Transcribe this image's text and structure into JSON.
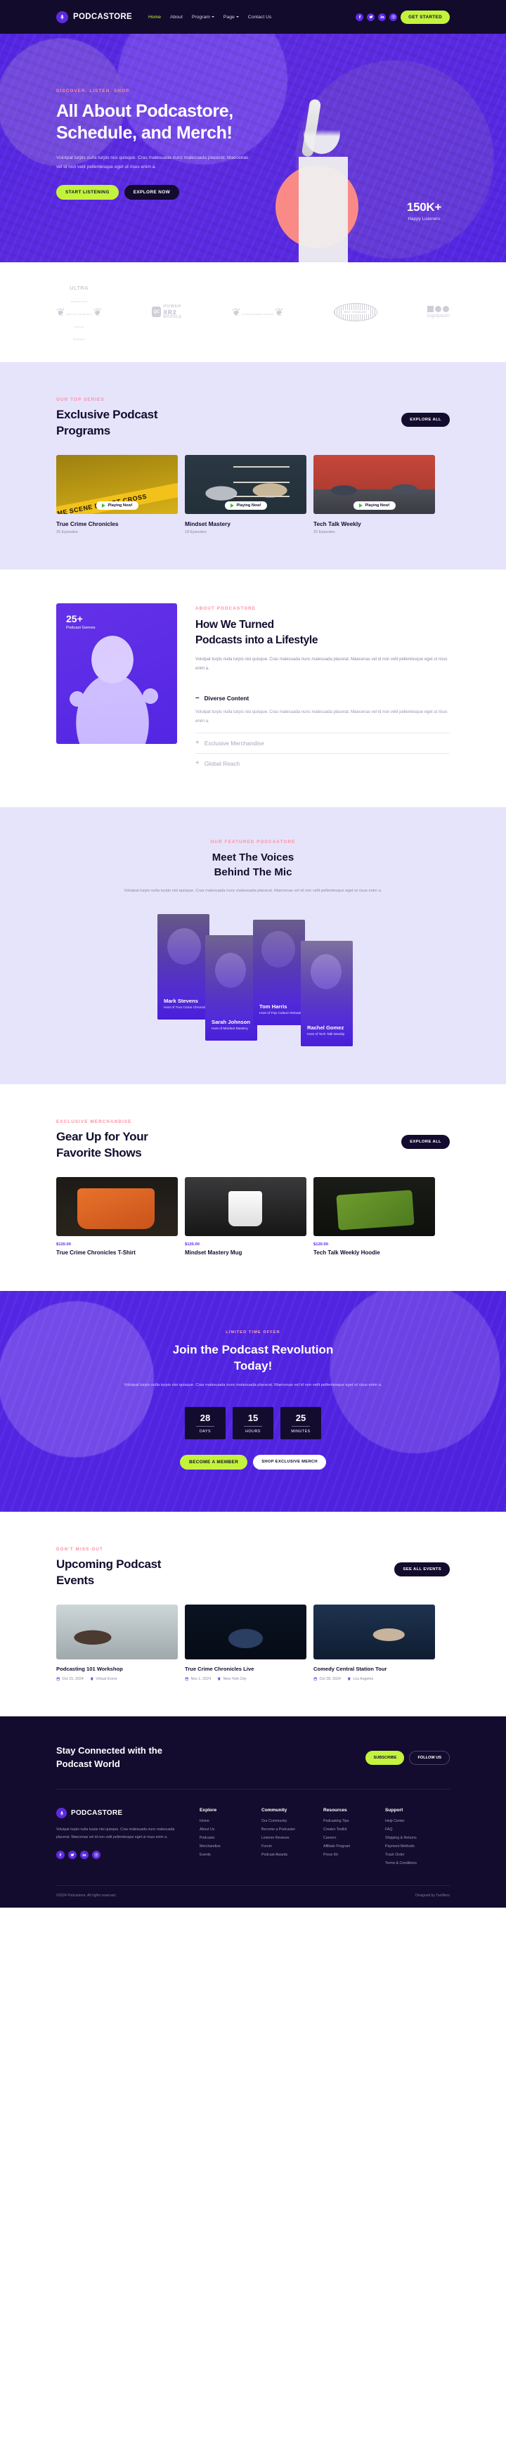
{
  "header": {
    "brand": "PODCASTORE",
    "nav": [
      {
        "label": "Home",
        "active": true,
        "caret": false
      },
      {
        "label": "About",
        "active": false,
        "caret": false
      },
      {
        "label": "Program",
        "active": false,
        "caret": true
      },
      {
        "label": "Page",
        "active": false,
        "caret": true
      },
      {
        "label": "Contact Us",
        "active": false,
        "caret": false
      }
    ],
    "socials": [
      "facebook-icon",
      "twitter-icon",
      "linkedin-icon",
      "instagram-icon"
    ],
    "cta_label": "GET STARTED",
    "accent_lime": "#c3f33c",
    "accent_purple": "#5c2be0",
    "dark": "#140c2e"
  },
  "hero": {
    "eyebrow": "DISCOVER. LISTEN. SHOP.",
    "title_line1": "All About Podcastore,",
    "title_line2": "Schedule, and Merch!",
    "description": "Volutpat turpis nulla turpis nisi quisque. Cras malesuada nunc malesuada placerat. Maecenas vel id non velit pellentesque eget ut risus enim a.",
    "btn_primary": "START LISTENING",
    "btn_secondary": "EXPLORE NOW",
    "stat_number": "150K+",
    "stat_label": "Happy Listeners"
  },
  "logos": [
    {
      "name": "ultra-prestigious-logo",
      "top": "ULTRA",
      "mid": "PRESTIGIOUS",
      "sub": "BEST OF THE WORLD",
      "stars": "★★★★★",
      "bottom": "WINNER"
    },
    {
      "name": "qc-power-xr2-logo",
      "badge": "QC",
      "p1": "POWER",
      "p2": "XR2",
      "p3": "MODULE"
    },
    {
      "name": "laurel-award-logo",
      "text": "ULTIMATE AWARD WINNER"
    },
    {
      "name": "best-standard-oval-logo",
      "text": "BEST STANDARD"
    },
    {
      "name": "logoipsum-logo",
      "text": "logoipsum"
    }
  ],
  "programs": {
    "eyebrow": "OUR TOP SERIES",
    "title_line1": "Exclusive Podcast",
    "title_line2": "Programs",
    "button": "EXPLORE ALL",
    "playing_label": "Playing Now!",
    "cards": [
      {
        "name": "True Crime Chronicles",
        "episodes": "25 Episodes",
        "thumb": "crime-scene-tape-image",
        "tape_text": "CRIME SCENE DO NOT CROSS"
      },
      {
        "name": "Mindset Mastery",
        "episodes": "18 Episodes",
        "thumb": "studio-interview-image",
        "tape_text": ""
      },
      {
        "name": "Tech Talk Weekly",
        "episodes": "32 Episodes",
        "thumb": "team-meeting-image",
        "tape_text": ""
      }
    ]
  },
  "about": {
    "badge_number": "25+",
    "badge_label": "Podcast Genres",
    "eyebrow": "ABOUT PODCASTORE",
    "title_line1": "How We Turned",
    "title_line2": "Podcasts into a Lifestyle",
    "description": "Volutpat turpis nulla turpis nisi quisque. Cras malesuada nunc malesuada placerat. Maecenas vel id non velit pellentesque eget ut risus enim a.",
    "accordion": [
      {
        "title": "Diverse Content",
        "open": true,
        "sign": "–",
        "body": "Volutpat turpis nulla turpis nisi quisque. Cras malesuada nunc malesuada placerat. Maecenas vel id non velit pellentesque eget ut risus enim a."
      },
      {
        "title": "Exclusive Merchandise",
        "open": false,
        "sign": "+",
        "body": ""
      },
      {
        "title": "Global Reach",
        "open": false,
        "sign": "+",
        "body": ""
      }
    ]
  },
  "hosts": {
    "eyebrow": "OUR FEATURED PODCASTORE",
    "title_line1": "Meet The Voices",
    "title_line2": "Behind The Mic",
    "subtitle": "Volutpat turpis nulla turpis nisi quisque. Cras malesuada nunc malesuada placerat. Maecenas vel id non velit pellentesque eget ut risus enim a.",
    "people": [
      {
        "name": "Mark Stevens",
        "role": "Host of True Crime Chronicles"
      },
      {
        "name": "Sarah Johnson",
        "role": "Host of Mindset Mastery"
      },
      {
        "name": "Tom Harris",
        "role": "Host of Pop Culture Reloaded"
      },
      {
        "name": "Rachel Gomez",
        "role": "Host of Tech Talk Weekly"
      }
    ]
  },
  "merch": {
    "eyebrow": "EXCLUSIVE MERCHANDISE",
    "title_line1": "Gear Up for Your",
    "title_line2": "Favorite Shows",
    "button": "EXPLORE ALL",
    "items": [
      {
        "price": "$120.00",
        "name": "True Crime Chronicles T-Shirt",
        "thumb": "tshirt-image"
      },
      {
        "price": "$120.00",
        "name": "Mindset Mastery Mug",
        "thumb": "mug-image"
      },
      {
        "price": "$120.00",
        "name": "Tech Talk Weekly Hoodie",
        "thumb": "hoodie-image"
      }
    ]
  },
  "cta": {
    "eyebrow": "LIMITED TIME OFFER",
    "title_line1": "Join the Podcast Revolution",
    "title_line2": "Today!",
    "description": "Volutpat turpis nulla turpis nisi quisque. Cras malesuada nunc malesuada placerat. Maecenas vel id non velit pellentesque eget ut risus enim a.",
    "timer": [
      {
        "value": "28",
        "label": "DAYS"
      },
      {
        "value": "15",
        "label": "HOURS"
      },
      {
        "value": "25",
        "label": "MINUTES"
      }
    ],
    "btn_primary": "BECOME A MEMBER",
    "btn_secondary": "SHOP EXCLUSIVE MERCH"
  },
  "events": {
    "eyebrow": "DON'T MISS OUT",
    "title_line1": "Upcoming Podcast",
    "title_line2": "Events",
    "button": "SEE ALL EVENTS",
    "items": [
      {
        "name": "Podcasting 101 Workshop",
        "date": "Oct 15, 2024",
        "location": "Virtual Event",
        "thumb": "workshop-image"
      },
      {
        "name": "True Crime Chronicles Live",
        "date": "Nov 1, 2024",
        "location": "New York City",
        "thumb": "live-show-image"
      },
      {
        "name": "Comedy Central Station Tour",
        "date": "Oct 28, 2024",
        "location": "Los Angeles",
        "thumb": "comedy-tour-image"
      }
    ]
  },
  "footer": {
    "headline_line1": "Stay Connected with the",
    "headline_line2": "Podcast World",
    "btn_subscribe": "SUBSCRIBE",
    "btn_follow": "FOLLOW US",
    "brand": "PODCASTORE",
    "description": "Volutpat turpis nulla turpis nisi quisque. Cras malesuada nunc malesuada placerat. Maecenas vel id non velit pellentesque eget ut risus enim a.",
    "socials": [
      "facebook-icon",
      "twitter-icon",
      "linkedin-icon",
      "instagram-icon"
    ],
    "columns": [
      {
        "title": "Explore",
        "links": [
          "Home",
          "About Us",
          "Podcasts",
          "Merchandise",
          "Events"
        ]
      },
      {
        "title": "Community",
        "links": [
          "Our Community",
          "Become a Podcaster",
          "Listener Reviews",
          "Forum",
          "Podcast Awards"
        ]
      },
      {
        "title": "Resources",
        "links": [
          "Podcasting Tips",
          "Creator Toolkit",
          "Careers",
          "Affiliate Program",
          "Press Kit"
        ]
      },
      {
        "title": "Support",
        "links": [
          "Help Center",
          "FAQ",
          "Shipping & Returns",
          "Payment Methods",
          "Track Order",
          "Terms & Conditions"
        ]
      }
    ],
    "copyright": "©2024 Podcastore. All rights reserved.",
    "credit": "Designed by Toolifiers"
  }
}
